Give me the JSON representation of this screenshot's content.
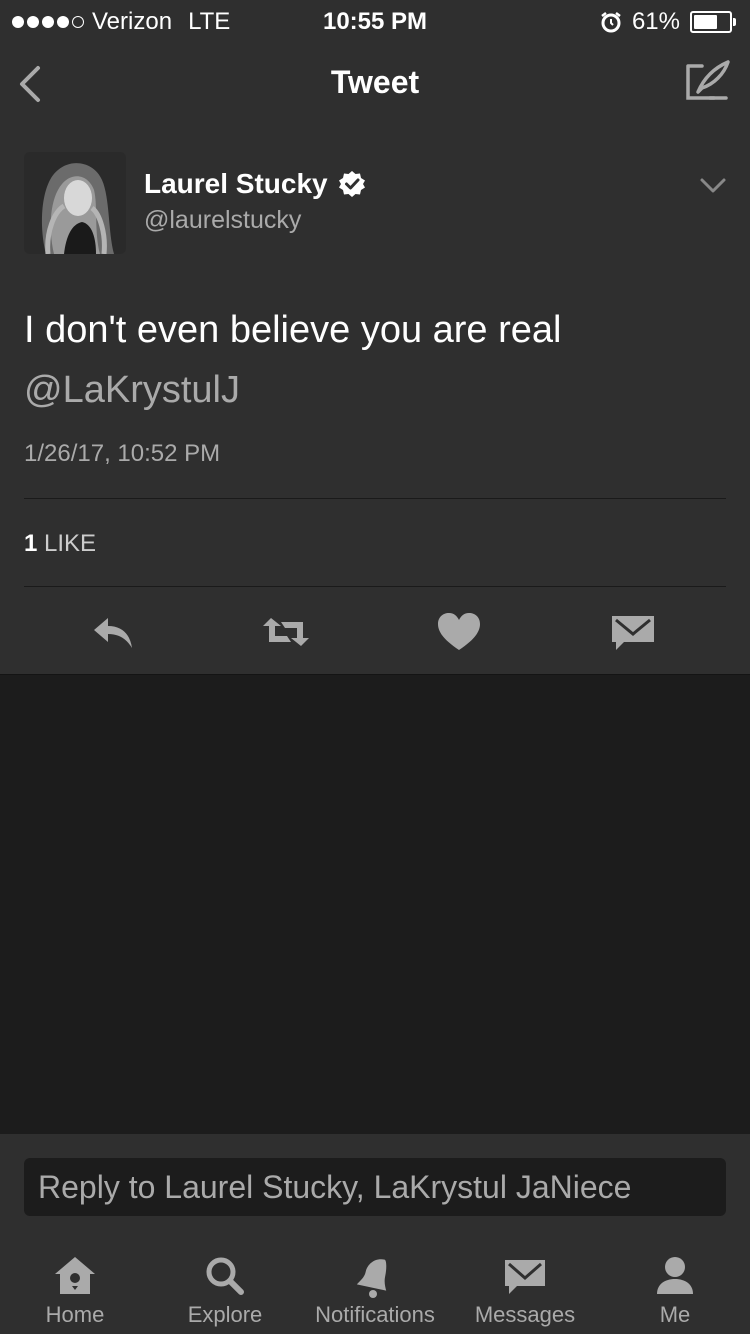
{
  "status_bar": {
    "carrier": "Verizon",
    "network": "LTE",
    "time": "10:55 PM",
    "battery_percent": "61%",
    "battery_level": 0.61,
    "signal_bars": 4
  },
  "nav": {
    "title": "Tweet",
    "back_icon": "chevron-left-icon",
    "compose_icon": "compose-icon"
  },
  "tweet": {
    "author_name": "Laurel Stucky",
    "author_handle": "@laurelstucky",
    "verified_icon": "verified-badge-icon",
    "text": "I don't even believe you are real",
    "mention": "@LaKrystulJ",
    "timestamp": "1/26/17, 10:52 PM",
    "like_count": "1",
    "like_label": "LIKE"
  },
  "actions": [
    {
      "icon": "reply-icon"
    },
    {
      "icon": "retweet-icon"
    },
    {
      "icon": "heart-icon"
    },
    {
      "icon": "message-icon"
    }
  ],
  "reply": {
    "placeholder": "Reply to Laurel Stucky, LaKrystul JaNiece"
  },
  "tabs": [
    {
      "label": "Home",
      "icon": "home-icon"
    },
    {
      "label": "Explore",
      "icon": "search-icon"
    },
    {
      "label": "Notifications",
      "icon": "bell-icon"
    },
    {
      "label": "Messages",
      "icon": "envelope-icon"
    },
    {
      "label": "Me",
      "icon": "person-icon"
    }
  ],
  "colors": {
    "background": "#1c1c1c",
    "panel": "#2f2f2f",
    "secondary_text": "#aaaaaa",
    "primary_text": "#ffffff"
  }
}
